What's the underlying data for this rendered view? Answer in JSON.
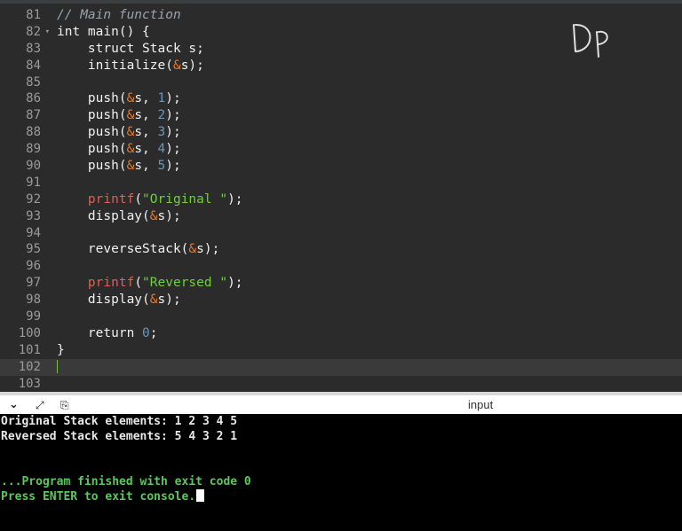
{
  "editor": {
    "line_numbers": [
      "81",
      "82",
      "83",
      "84",
      "85",
      "86",
      "87",
      "88",
      "89",
      "90",
      "91",
      "92",
      "93",
      "94",
      "95",
      "96",
      "97",
      "98",
      "99",
      "100",
      "101",
      "102",
      "103"
    ],
    "lines": [
      {
        "num": "81",
        "tokens": [
          {
            "t": "// Main function",
            "c": "comment"
          }
        ]
      },
      {
        "num": "82",
        "fold": true,
        "tokens": [
          {
            "t": "int main() {",
            "c": "plain"
          }
        ]
      },
      {
        "num": "83",
        "tokens": [
          {
            "t": "    struct Stack s;",
            "c": "plain"
          }
        ]
      },
      {
        "num": "84",
        "tokens": [
          {
            "t": "    initialize(",
            "c": "plain"
          },
          {
            "t": "&",
            "c": "amp"
          },
          {
            "t": "s);",
            "c": "plain"
          }
        ]
      },
      {
        "num": "85",
        "tokens": []
      },
      {
        "num": "86",
        "tokens": [
          {
            "t": "    push(",
            "c": "plain"
          },
          {
            "t": "&",
            "c": "amp"
          },
          {
            "t": "s, ",
            "c": "plain"
          },
          {
            "t": "1",
            "c": "num"
          },
          {
            "t": ");",
            "c": "plain"
          }
        ]
      },
      {
        "num": "87",
        "tokens": [
          {
            "t": "    push(",
            "c": "plain"
          },
          {
            "t": "&",
            "c": "amp"
          },
          {
            "t": "s, ",
            "c": "plain"
          },
          {
            "t": "2",
            "c": "num"
          },
          {
            "t": ");",
            "c": "plain"
          }
        ]
      },
      {
        "num": "88",
        "tokens": [
          {
            "t": "    push(",
            "c": "plain"
          },
          {
            "t": "&",
            "c": "amp"
          },
          {
            "t": "s, ",
            "c": "plain"
          },
          {
            "t": "3",
            "c": "num"
          },
          {
            "t": ");",
            "c": "plain"
          }
        ]
      },
      {
        "num": "89",
        "tokens": [
          {
            "t": "    push(",
            "c": "plain"
          },
          {
            "t": "&",
            "c": "amp"
          },
          {
            "t": "s, ",
            "c": "plain"
          },
          {
            "t": "4",
            "c": "num"
          },
          {
            "t": ");",
            "c": "plain"
          }
        ]
      },
      {
        "num": "90",
        "tokens": [
          {
            "t": "    push(",
            "c": "plain"
          },
          {
            "t": "&",
            "c": "amp"
          },
          {
            "t": "s, ",
            "c": "plain"
          },
          {
            "t": "5",
            "c": "num"
          },
          {
            "t": ");",
            "c": "plain"
          }
        ]
      },
      {
        "num": "91",
        "tokens": []
      },
      {
        "num": "92",
        "tokens": [
          {
            "t": "    ",
            "c": "plain"
          },
          {
            "t": "printf",
            "c": "printf"
          },
          {
            "t": "(",
            "c": "plain"
          },
          {
            "t": "\"Original \"",
            "c": "str"
          },
          {
            "t": ");",
            "c": "plain"
          }
        ]
      },
      {
        "num": "93",
        "tokens": [
          {
            "t": "    display(",
            "c": "plain"
          },
          {
            "t": "&",
            "c": "amp"
          },
          {
            "t": "s);",
            "c": "plain"
          }
        ]
      },
      {
        "num": "94",
        "tokens": []
      },
      {
        "num": "95",
        "tokens": [
          {
            "t": "    reverseStack(",
            "c": "plain"
          },
          {
            "t": "&",
            "c": "amp"
          },
          {
            "t": "s);",
            "c": "plain"
          }
        ]
      },
      {
        "num": "96",
        "tokens": []
      },
      {
        "num": "97",
        "tokens": [
          {
            "t": "    ",
            "c": "plain"
          },
          {
            "t": "printf",
            "c": "printf"
          },
          {
            "t": "(",
            "c": "plain"
          },
          {
            "t": "\"Reversed \"",
            "c": "str"
          },
          {
            "t": ");",
            "c": "plain"
          }
        ]
      },
      {
        "num": "98",
        "tokens": [
          {
            "t": "    display(",
            "c": "plain"
          },
          {
            "t": "&",
            "c": "amp"
          },
          {
            "t": "s);",
            "c": "plain"
          }
        ]
      },
      {
        "num": "99",
        "tokens": []
      },
      {
        "num": "100",
        "tokens": [
          {
            "t": "    return ",
            "c": "plain"
          },
          {
            "t": "0",
            "c": "num"
          },
          {
            "t": ";",
            "c": "plain"
          }
        ]
      },
      {
        "num": "101",
        "tokens": [
          {
            "t": "}",
            "c": "plain"
          }
        ]
      },
      {
        "num": "102",
        "active": true,
        "tokens": []
      },
      {
        "num": "103",
        "tokens": []
      }
    ],
    "signature": "DP"
  },
  "toolbar": {
    "collapse_icon": "chevron-down-icon",
    "expand_icon": "expand-arrows-icon",
    "copy_icon": "clipboard-icon",
    "input_label": "input"
  },
  "console": {
    "lines": [
      {
        "text": "Original Stack elements: 1 2 3 4 5",
        "style": "out"
      },
      {
        "text": "Reversed Stack elements: 5 4 3 2 1",
        "style": "out"
      },
      {
        "text": "",
        "style": "out"
      },
      {
        "text": "",
        "style": "out"
      },
      {
        "text": "...Program finished with exit code 0",
        "style": "green"
      },
      {
        "text": "Press ENTER to exit console.",
        "style": "green",
        "cursor": true
      }
    ]
  },
  "colors": {
    "editor_bg": "#2b2b2b",
    "comment": "#9aa3ad",
    "ampersand": "#e57a2e",
    "number": "#6897bb",
    "string": "#6fcf3f",
    "printf": "#e06050",
    "console_green": "#5ac85a"
  }
}
